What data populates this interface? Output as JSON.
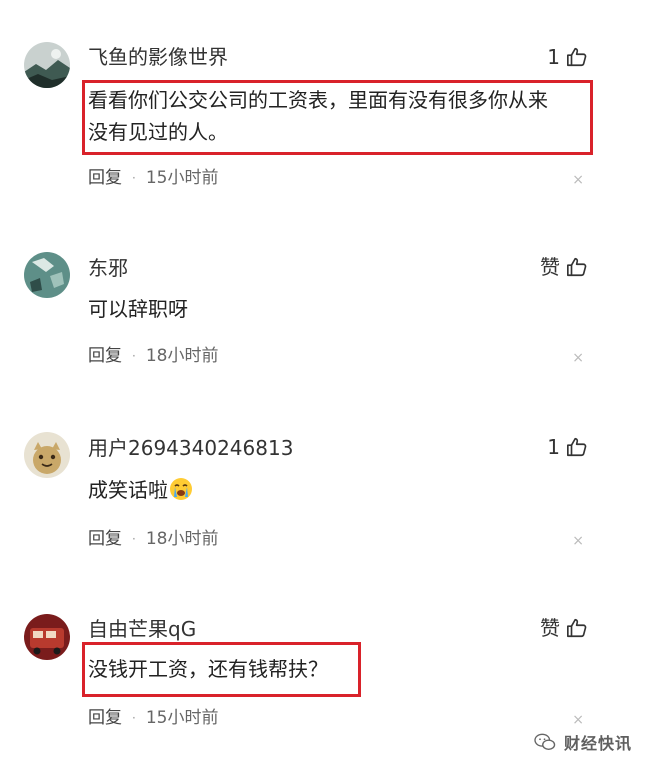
{
  "comments": [
    {
      "username": "飞鱼的影像世界",
      "like_label": "1",
      "content_lines": [
        "看看你们公交公司的工资表，里面有没有很多你从来",
        "没有见过的人。"
      ],
      "reply_label": "回复",
      "separator": "·",
      "time": "15小时前",
      "close_glyph": "×",
      "highlighted": true
    },
    {
      "username": "东邪",
      "like_label": "赞",
      "content_lines": [
        "可以辞职呀"
      ],
      "reply_label": "回复",
      "separator": "·",
      "time": "18小时前",
      "close_glyph": "×",
      "highlighted": false
    },
    {
      "username": "用户2694340246813",
      "like_label": "1",
      "content_lines": [
        "成笑话啦"
      ],
      "reply_label": "回复",
      "separator": "·",
      "time": "18小时前",
      "close_glyph": "×",
      "highlighted": false,
      "emoji": "crying-face"
    },
    {
      "username": "自由芒果qG",
      "like_label": "赞",
      "content_lines": [
        "没钱开工资，还有钱帮扶？"
      ],
      "reply_label": "回复",
      "separator": "·",
      "time": "15小时前",
      "close_glyph": "×",
      "highlighted": true
    }
  ],
  "watermark": {
    "text": "财经快讯",
    "icon": "wechat-icon"
  },
  "colors": {
    "highlight": "#d9222a",
    "text": "#222222",
    "meta": "#666666"
  }
}
